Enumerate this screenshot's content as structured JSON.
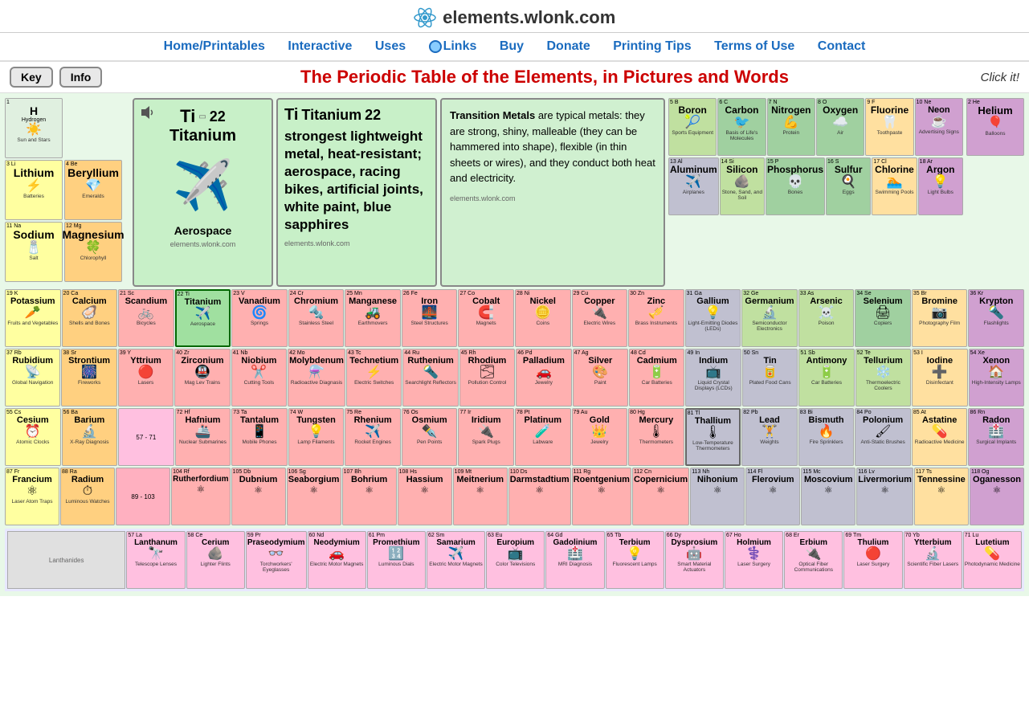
{
  "site": {
    "title": "elements.wlonk.com",
    "page_title": "The Periodic Table of the Elements, in Pictures and Words",
    "click_it": "Click it!"
  },
  "nav": {
    "items": [
      {
        "label": "Home/Printables",
        "href": "#"
      },
      {
        "label": "Interactive",
        "href": "#"
      },
      {
        "label": "Uses",
        "href": "#"
      },
      {
        "label": "Links",
        "href": "#",
        "globe": true
      },
      {
        "label": "Buy",
        "href": "#"
      },
      {
        "label": "Donate",
        "href": "#"
      },
      {
        "label": "Printing Tips",
        "href": "#"
      },
      {
        "label": "Terms of Use",
        "href": "#"
      },
      {
        "label": "Contact",
        "href": "#"
      }
    ]
  },
  "buttons": {
    "key": "Key",
    "info": "Info"
  },
  "selected_element": {
    "symbol": "Ti",
    "name": "Titanium",
    "number": "22",
    "description": "strongest lightweight metal, heat-resistant; aerospace, racing bikes, artificial joints, white paint, blue sapphires",
    "use": "Aerospace",
    "source": "elements.wlonk.com"
  },
  "info_box": {
    "title": "Transition Metals",
    "text": "are typical metals: they are strong, shiny, malleable (they can be hammered into shape), flexible (in thin sheets or wires), and they conduct both heat and electricity.",
    "source": "elements.wlonk.com"
  },
  "elements": [
    {
      "n": 1,
      "s": "H",
      "nm": "Hydrogen",
      "ic": "☀️",
      "u": "Sun and Stars",
      "bg": "bg-hydrogen"
    },
    {
      "n": 2,
      "s": "He",
      "nm": "Helium",
      "ic": "🎈",
      "u": "Balloons",
      "bg": "bg-noble"
    },
    {
      "n": 3,
      "s": "Li",
      "nm": "Lithium",
      "ic": "⚡",
      "u": "Batteries",
      "bg": "bg-alkali"
    },
    {
      "n": 4,
      "s": "Be",
      "nm": "Beryllium",
      "ic": "💎",
      "u": "Emeralds",
      "bg": "bg-alkaline"
    },
    {
      "n": 5,
      "s": "B",
      "nm": "Boron",
      "ic": "🎾",
      "u": "Sports Equipment",
      "bg": "bg-metalloid"
    },
    {
      "n": 6,
      "s": "C",
      "nm": "Carbon",
      "ic": "🐦",
      "u": "Basis of Life's Molecules",
      "bg": "bg-nonmetal"
    },
    {
      "n": 7,
      "s": "N",
      "nm": "Nitrogen",
      "ic": "💪",
      "u": "Protein",
      "bg": "bg-nonmetal"
    },
    {
      "n": 8,
      "s": "O",
      "nm": "Oxygen",
      "ic": "🌤",
      "u": "Air",
      "bg": "bg-nonmetal"
    },
    {
      "n": 9,
      "s": "F",
      "nm": "Fluorine",
      "ic": "🦷",
      "u": "Toothpaste",
      "bg": "bg-halogen"
    },
    {
      "n": 10,
      "s": "Ne",
      "nm": "Neon",
      "ic": "☕",
      "u": "Advertising Signs",
      "bg": "bg-noble"
    },
    {
      "n": 11,
      "s": "Na",
      "nm": "Sodium",
      "ic": "🧂",
      "u": "Salt",
      "bg": "bg-alkali"
    },
    {
      "n": 12,
      "s": "Mg",
      "nm": "Magnesium",
      "ic": "🍀",
      "u": "Chlorophyll",
      "bg": "bg-alkaline"
    },
    {
      "n": 13,
      "s": "Al",
      "nm": "Aluminum",
      "ic": "✈️",
      "u": "Airplanes",
      "bg": "bg-post-transition"
    },
    {
      "n": 14,
      "s": "Si",
      "nm": "Silicon",
      "ic": "🪨",
      "u": "Stone, Sand, and Soil",
      "bg": "bg-metalloid"
    },
    {
      "n": 15,
      "s": "P",
      "nm": "Phosphorus",
      "ic": "💀",
      "u": "Bones",
      "bg": "bg-nonmetal"
    },
    {
      "n": 16,
      "s": "S",
      "nm": "Sulfur",
      "ic": "🍳",
      "u": "Eggs",
      "bg": "bg-nonmetal"
    },
    {
      "n": 17,
      "s": "Cl",
      "nm": "Chlorine",
      "ic": "🏊",
      "u": "Swimming Pools",
      "bg": "bg-halogen"
    },
    {
      "n": 18,
      "s": "Ar",
      "nm": "Argon",
      "ic": "💡",
      "u": "Light Bulbs",
      "bg": "bg-noble"
    },
    {
      "n": 19,
      "s": "K",
      "nm": "Potassium",
      "ic": "🥕",
      "u": "Fruits and Vegetables",
      "bg": "bg-alkali"
    },
    {
      "n": 20,
      "s": "Ca",
      "nm": "Calcium",
      "ic": "🦪",
      "u": "Shells and Bones",
      "bg": "bg-alkaline"
    },
    {
      "n": 21,
      "s": "Sc",
      "nm": "Scandium",
      "ic": "🚲",
      "u": "Bicycles",
      "bg": "bg-transition"
    },
    {
      "n": 22,
      "s": "Ti",
      "nm": "Titanium",
      "ic": "✈️",
      "u": "Aerospace",
      "bg": "bg-selected"
    },
    {
      "n": 23,
      "s": "V",
      "nm": "Vanadium",
      "ic": "🌀",
      "u": "Springs",
      "bg": "bg-transition"
    },
    {
      "n": 24,
      "s": "Cr",
      "nm": "Chromium",
      "ic": "🔩",
      "u": "Stainless Steel",
      "bg": "bg-transition"
    },
    {
      "n": 25,
      "s": "Mn",
      "nm": "Manganese",
      "ic": "🚜",
      "u": "Earthmovers",
      "bg": "bg-transition"
    },
    {
      "n": 26,
      "s": "Fe",
      "nm": "Iron",
      "ic": "🌉",
      "u": "Steel Structures",
      "bg": "bg-transition"
    },
    {
      "n": 27,
      "s": "Co",
      "nm": "Cobalt",
      "ic": "🧲",
      "u": "Magnets",
      "bg": "bg-transition"
    },
    {
      "n": 28,
      "s": "Ni",
      "nm": "Nickel",
      "ic": "🪙",
      "u": "Coins",
      "bg": "bg-transition"
    },
    {
      "n": 29,
      "s": "Cu",
      "nm": "Copper",
      "ic": "🔌",
      "u": "Electric Wires",
      "bg": "bg-transition"
    },
    {
      "n": 30,
      "s": "Zn",
      "nm": "Zinc",
      "ic": "🎺",
      "u": "Brass Instruments",
      "bg": "bg-transition"
    },
    {
      "n": 31,
      "s": "Ga",
      "nm": "Gallium",
      "ic": "💡",
      "u": "Light-Emitting Diodes (LEDs)",
      "bg": "bg-post-transition"
    },
    {
      "n": 32,
      "s": "Ge",
      "nm": "Germanium",
      "ic": "🔬",
      "u": "Semiconductor Electronics",
      "bg": "bg-metalloid"
    },
    {
      "n": 33,
      "s": "As",
      "nm": "Arsenic",
      "ic": "☠️",
      "u": "Poison",
      "bg": "bg-metalloid"
    },
    {
      "n": 34,
      "s": "Se",
      "nm": "Selenium",
      "ic": "🖨",
      "u": "Copiers",
      "bg": "bg-nonmetal"
    },
    {
      "n": 35,
      "s": "Br",
      "nm": "Bromine",
      "ic": "📷",
      "u": "Photography Film",
      "bg": "bg-halogen"
    },
    {
      "n": 36,
      "s": "Kr",
      "nm": "Krypton",
      "ic": "🔦",
      "u": "Flashlights",
      "bg": "bg-noble"
    },
    {
      "n": 37,
      "s": "Rb",
      "nm": "Rubidium",
      "ic": "📡",
      "u": "Global Navigation",
      "bg": "bg-alkali"
    },
    {
      "n": 38,
      "s": "Sr",
      "nm": "Strontium",
      "ic": "🎆",
      "u": "Fireworks",
      "bg": "bg-alkaline"
    },
    {
      "n": 39,
      "s": "Y",
      "nm": "Yttrium",
      "ic": "🔴",
      "u": "Lasers",
      "bg": "bg-transition"
    },
    {
      "n": 40,
      "s": "Zr",
      "nm": "Zirconium",
      "ic": "🚇",
      "u": "Mag Lev Trains",
      "bg": "bg-transition"
    },
    {
      "n": 41,
      "s": "Nb",
      "nm": "Niobium",
      "ic": "✂️",
      "u": "Cutting Tools",
      "bg": "bg-transition"
    },
    {
      "n": 42,
      "s": "Mo",
      "nm": "Molybdenum",
      "ic": "⚗️",
      "u": "Radioactive Diagnasis",
      "bg": "bg-transition"
    },
    {
      "n": 43,
      "s": "Tc",
      "nm": "Technetium",
      "ic": "⚡",
      "u": "Electric Switches",
      "bg": "bg-transition"
    },
    {
      "n": 44,
      "s": "Ru",
      "nm": "Ruthenium",
      "ic": "🔦",
      "u": "Searchlight Reflectors",
      "bg": "bg-transition"
    },
    {
      "n": 45,
      "s": "Rh",
      "nm": "Rhodium",
      "ic": "🌫",
      "u": "Pollution Control",
      "bg": "bg-transition"
    },
    {
      "n": 46,
      "s": "Pd",
      "nm": "Palladium",
      "ic": "🚗",
      "u": "Jewelry",
      "bg": "bg-transition"
    },
    {
      "n": 47,
      "s": "Ag",
      "nm": "Silver",
      "ic": "🎨",
      "u": "Paint",
      "bg": "bg-transition"
    },
    {
      "n": 48,
      "s": "Cd",
      "nm": "Cadmium",
      "ic": "🔋",
      "u": "Car Batteries",
      "bg": "bg-transition"
    },
    {
      "n": 49,
      "s": "In",
      "nm": "Indium",
      "ic": "📺",
      "u": "Liquid Crystal Displays (LCDs)",
      "bg": "bg-post-transition"
    },
    {
      "n": 50,
      "s": "Sn",
      "nm": "Tin",
      "ic": "🥫",
      "u": "Plated Food Cans",
      "bg": "bg-post-transition"
    },
    {
      "n": 51,
      "s": "Sb",
      "nm": "Antimony",
      "ic": "🔋",
      "u": "Car Batteries",
      "bg": "bg-metalloid"
    },
    {
      "n": 52,
      "s": "Te",
      "nm": "Tellurium",
      "ic": "❄️",
      "u": "Thermoelectric Coolers",
      "bg": "bg-metalloid"
    },
    {
      "n": 53,
      "s": "I",
      "nm": "Iodine",
      "ic": "➕",
      "u": "Disinfectant",
      "bg": "bg-halogen"
    },
    {
      "n": 54,
      "s": "Xe",
      "nm": "Xenon",
      "ic": "🏠",
      "u": "High-Intensity Lamps",
      "bg": "bg-noble"
    },
    {
      "n": 55,
      "s": "Cs",
      "nm": "Cesium",
      "ic": "⏰",
      "u": "Atomic Clocks",
      "bg": "bg-alkali"
    },
    {
      "n": 56,
      "s": "Ba",
      "nm": "Barium",
      "ic": "🔬",
      "u": "X-Ray Diagnosis",
      "bg": "bg-alkaline"
    },
    {
      "n": 72,
      "s": "Hf",
      "nm": "Hafnium",
      "ic": "🚢",
      "u": "Nuclear Submarines",
      "bg": "bg-transition"
    },
    {
      "n": 73,
      "s": "Ta",
      "nm": "Tantalum",
      "ic": "📱",
      "u": "Mobile Phones",
      "bg": "bg-transition"
    },
    {
      "n": 74,
      "s": "W",
      "nm": "Tungsten",
      "ic": "💡",
      "u": "Lamp Filaments",
      "bg": "bg-transition"
    },
    {
      "n": 75,
      "s": "Re",
      "nm": "Rhenium",
      "ic": "✈️",
      "u": "Rocket Engines",
      "bg": "bg-transition"
    },
    {
      "n": 76,
      "s": "Os",
      "nm": "Osmium",
      "ic": "✒️",
      "u": "Pen Points",
      "bg": "bg-transition"
    },
    {
      "n": 77,
      "s": "Ir",
      "nm": "Iridium",
      "ic": "🔌",
      "u": "Spark Plugs",
      "bg": "bg-transition"
    },
    {
      "n": 78,
      "s": "Pt",
      "nm": "Platinum",
      "ic": "🧪",
      "u": "Labware",
      "bg": "bg-transition"
    },
    {
      "n": 79,
      "s": "Au",
      "nm": "Gold",
      "ic": "👑",
      "u": "Jewelry",
      "bg": "bg-transition"
    },
    {
      "n": 80,
      "s": "Hg",
      "nm": "Mercury",
      "ic": "🌡",
      "u": "Thermometers",
      "bg": "bg-transition"
    },
    {
      "n": 81,
      "s": "Tl",
      "nm": "Thallium",
      "ic": "🌡",
      "u": "Low-Temperature Thermometers",
      "bg": "bg-post-transition"
    },
    {
      "n": 82,
      "s": "Pb",
      "nm": "Lead",
      "ic": "🏋",
      "u": "Weights",
      "bg": "bg-post-transition"
    },
    {
      "n": 83,
      "s": "Bi",
      "nm": "Bismuth",
      "ic": "🔥",
      "u": "Fire Sprinklers",
      "bg": "bg-post-transition"
    },
    {
      "n": 84,
      "s": "Po",
      "nm": "Polonium",
      "ic": "🖌",
      "u": "Anti-Static Brushes",
      "bg": "bg-post-transition"
    },
    {
      "n": 85,
      "s": "At",
      "nm": "Astatine",
      "ic": "💊",
      "u": "Radioactive Medicine",
      "bg": "bg-halogen"
    },
    {
      "n": 86,
      "s": "Rn",
      "nm": "Radon",
      "ic": "🏥",
      "u": "Surgical Implants",
      "bg": "bg-noble"
    },
    {
      "n": 87,
      "s": "Fr",
      "nm": "Francium",
      "ic": "⚛",
      "u": "Laser Atom Traps",
      "bg": "bg-alkali"
    },
    {
      "n": 88,
      "s": "Ra",
      "nm": "Radium",
      "ic": "⏱",
      "u": "Luminous Watches",
      "bg": "bg-alkaline"
    }
  ],
  "lanthanides": [
    {
      "n": 57,
      "s": "La",
      "nm": "Lanthanum",
      "ic": "🔭",
      "u": "Telescope Lenses",
      "bg": "bg-lanthanide"
    },
    {
      "n": 58,
      "s": "Ce",
      "nm": "Cerium",
      "ic": "🪨",
      "u": "Lighter Flints",
      "bg": "bg-lanthanide"
    },
    {
      "n": 59,
      "s": "Pr",
      "nm": "Praseodymium",
      "ic": "👓",
      "u": "Torchworkers' Eyeglasses",
      "bg": "bg-lanthanide"
    },
    {
      "n": 60,
      "s": "Nd",
      "nm": "Neodymium",
      "ic": "🚗",
      "u": "Electric Motor Magnets",
      "bg": "bg-lanthanide"
    },
    {
      "n": 61,
      "s": "Pm",
      "nm": "Promethium",
      "ic": "🔢",
      "u": "Luminous Dials",
      "bg": "bg-lanthanide"
    },
    {
      "n": 62,
      "s": "Sm",
      "nm": "Samarium",
      "ic": "✈️",
      "u": "Electric Motor Magnets",
      "bg": "bg-lanthanide"
    },
    {
      "n": 63,
      "s": "Eu",
      "nm": "Europium",
      "ic": "📺",
      "u": "Color Televisions",
      "bg": "bg-lanthanide"
    },
    {
      "n": 64,
      "s": "Gd",
      "nm": "Gadolinium",
      "ic": "🏥",
      "u": "MRI Diagnosis",
      "bg": "bg-lanthanide"
    },
    {
      "n": 65,
      "s": "Tb",
      "nm": "Terbium",
      "ic": "💡",
      "u": "Fluorescent Lamps",
      "bg": "bg-lanthanide"
    },
    {
      "n": 66,
      "s": "Dy",
      "nm": "Dysprosium",
      "ic": "🤖",
      "u": "Smart Material Actuators",
      "bg": "bg-lanthanide"
    },
    {
      "n": 67,
      "s": "Ho",
      "nm": "Holmium",
      "ic": "⚕️",
      "u": "Laser Surgery",
      "bg": "bg-lanthanide"
    },
    {
      "n": 68,
      "s": "Er",
      "nm": "Erbium",
      "ic": "🔌",
      "u": "Optical Fiber Communications",
      "bg": "bg-lanthanide"
    },
    {
      "n": 69,
      "s": "Tm",
      "nm": "Thulium",
      "ic": "🔴",
      "u": "Laser Surgery",
      "bg": "bg-lanthanide"
    },
    {
      "n": 70,
      "s": "Yb",
      "nm": "Ytterbium",
      "ic": "🔬",
      "u": "Scientific Fiber Lasers",
      "bg": "bg-lanthanide"
    },
    {
      "n": 71,
      "s": "Lu",
      "nm": "Lutetium",
      "ic": "💊",
      "u": "Photodynamic Medicine",
      "bg": "bg-lanthanide"
    }
  ],
  "thallium_label": "Thallium"
}
